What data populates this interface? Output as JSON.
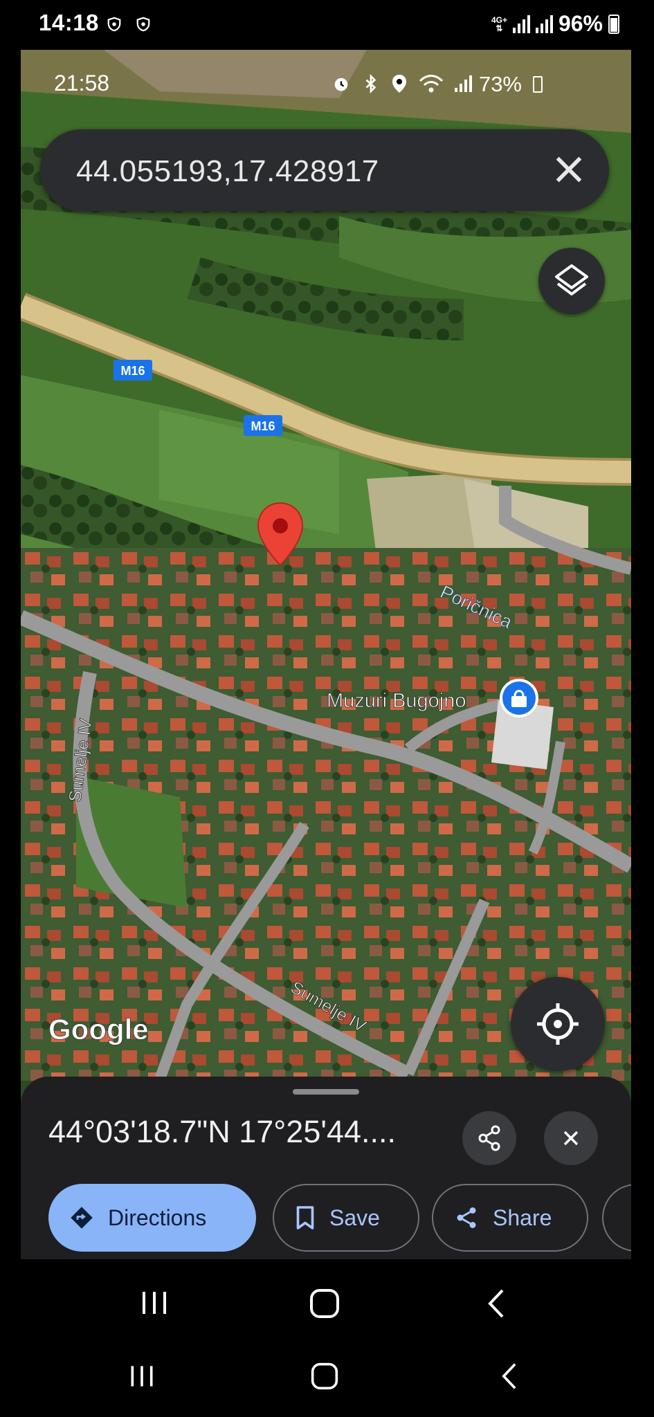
{
  "outer_status": {
    "time": "14:18",
    "network": "4G+",
    "battery": "96%"
  },
  "inner_status": {
    "time": "21:58",
    "battery": "73%"
  },
  "search": {
    "value": "44.055193,17.428917"
  },
  "map": {
    "road_labels": [
      "M16",
      "M16"
    ],
    "river_label": "Poričnica",
    "street_labels": [
      "Sumelje IV",
      "Sumelje IV"
    ],
    "place_label": "Muzuri Bugojno",
    "watermark": "Google",
    "colors": {
      "road": "#d7c38a",
      "road_border": "#a38e55",
      "street": "#9a9a9a",
      "pin": "#ea4335",
      "place_pin": "#1a73e8",
      "route_shield": "#1a73e8"
    }
  },
  "sheet": {
    "coordinates": "44°03'18.7\"N 17°25'44....",
    "actions": [
      {
        "label": "Directions",
        "icon": "directions-icon"
      },
      {
        "label": "Save",
        "icon": "bookmark-icon"
      },
      {
        "label": "Share",
        "icon": "share-icon"
      }
    ]
  }
}
